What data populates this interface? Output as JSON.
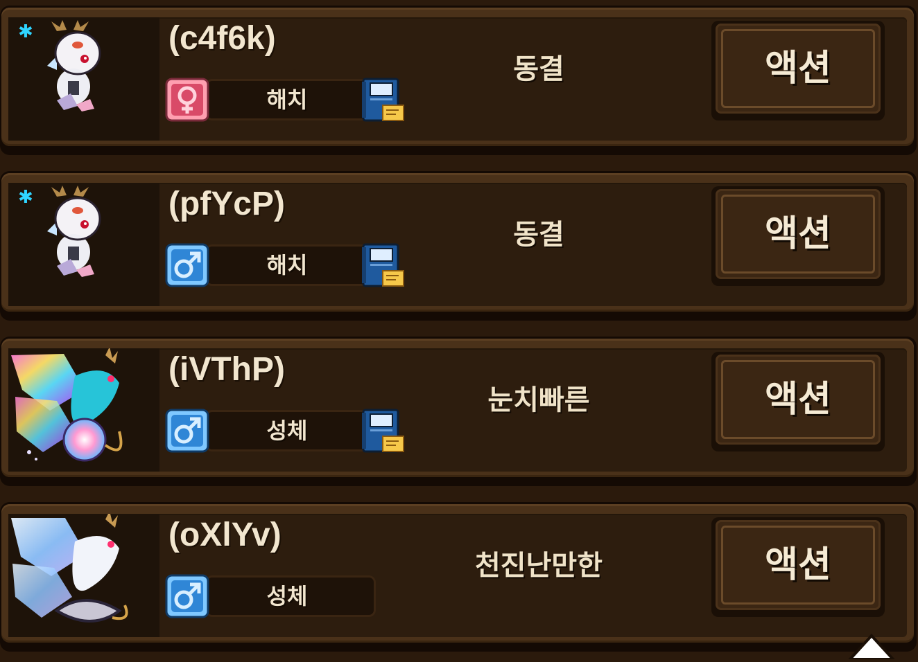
{
  "creatures": [
    {
      "name": "(c4f6k)",
      "frozen": true,
      "frozen_icon": "snowflake-icon",
      "gender": "female",
      "gender_icon": "female-symbol-icon",
      "stage": "해치",
      "has_journal": true,
      "status": "동결",
      "action_label": "액션",
      "portrait": "white-hatchling-dragon"
    },
    {
      "name": "(pfYcP)",
      "frozen": true,
      "frozen_icon": "snowflake-icon",
      "gender": "male",
      "gender_icon": "male-symbol-icon",
      "stage": "해치",
      "has_journal": true,
      "status": "동결",
      "action_label": "액션",
      "portrait": "white-hatchling-dragon"
    },
    {
      "name": "(iVThP)",
      "frozen": false,
      "gender": "male",
      "gender_icon": "male-symbol-icon",
      "stage": "성체",
      "has_journal": true,
      "status": "눈치빠른",
      "action_label": "액션",
      "portrait": "rainbow-winged-dragon"
    },
    {
      "name": "(oXlYv)",
      "frozen": false,
      "gender": "male",
      "gender_icon": "male-symbol-icon",
      "stage": "성체",
      "has_journal": false,
      "status": "천진난만한",
      "action_label": "액션",
      "portrait": "blue-winged-dragon"
    }
  ],
  "colors": {
    "female": "#e2607a",
    "male": "#2f86d6",
    "frozen": "#2fd4ff",
    "panel": "#2d1d0e",
    "frame": "#4a3119"
  }
}
